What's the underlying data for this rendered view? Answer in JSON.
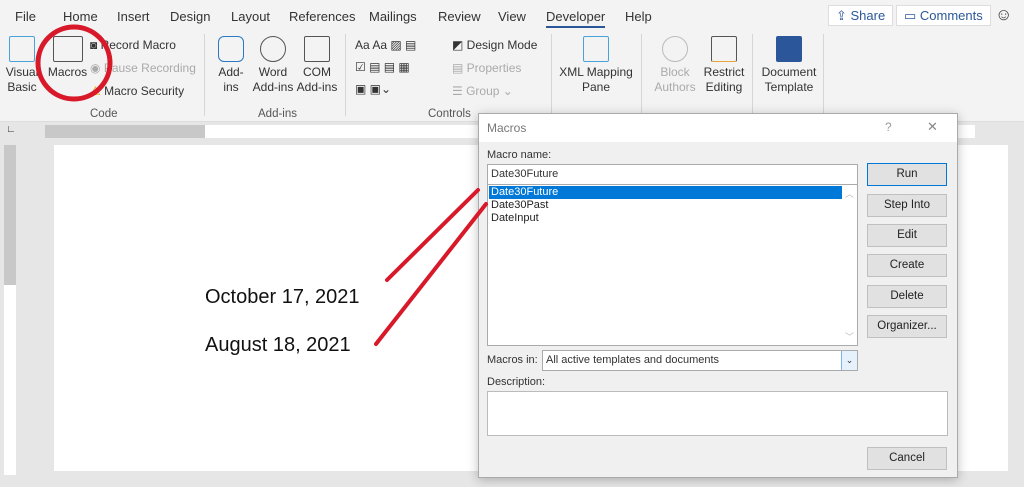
{
  "tabs": [
    "File",
    "Home",
    "Insert",
    "Design",
    "Layout",
    "References",
    "Mailings",
    "Review",
    "View",
    "Developer",
    "Help"
  ],
  "active_tab": "Developer",
  "top_buttons": {
    "share": "Share",
    "comments": "Comments"
  },
  "ribbon": {
    "code": {
      "visual_basic": "Visual Basic",
      "macros": "Macros",
      "record": "Record Macro",
      "pause": "Pause Recording",
      "security": "Macro Security",
      "label": "Code"
    },
    "addins": {
      "addins": "Add-ins",
      "word": "Word Add-ins",
      "com": "COM Add-ins",
      "label": "Add-ins"
    },
    "controls": {
      "design_mode": "Design Mode",
      "properties": "Properties",
      "group": "Group",
      "label": "Controls"
    },
    "mapping": {
      "xml": "XML Mapping Pane"
    },
    "protect": {
      "block": "Block Authors",
      "restrict": "Restrict Editing"
    },
    "templates": {
      "doc_template": "Document Template"
    }
  },
  "document": {
    "lines": [
      "October 17, 2021",
      "August 18, 2021"
    ]
  },
  "annotation_color": "#d7192a",
  "dialog": {
    "title": "Macros",
    "help": "?",
    "close": "✕",
    "macro_name_label": "Macro name:",
    "macro_name_value": "Date30Future",
    "macros": [
      "Date30Future",
      "Date30Past",
      "DateInput"
    ],
    "selected": "Date30Future",
    "macros_in_label": "Macros in:",
    "macros_in_value": "All active templates and documents",
    "description_label": "Description:",
    "buttons": {
      "run": "Run",
      "step_into": "Step Into",
      "edit": "Edit",
      "create": "Create",
      "delete": "Delete",
      "organizer": "Organizer...",
      "cancel": "Cancel"
    }
  }
}
